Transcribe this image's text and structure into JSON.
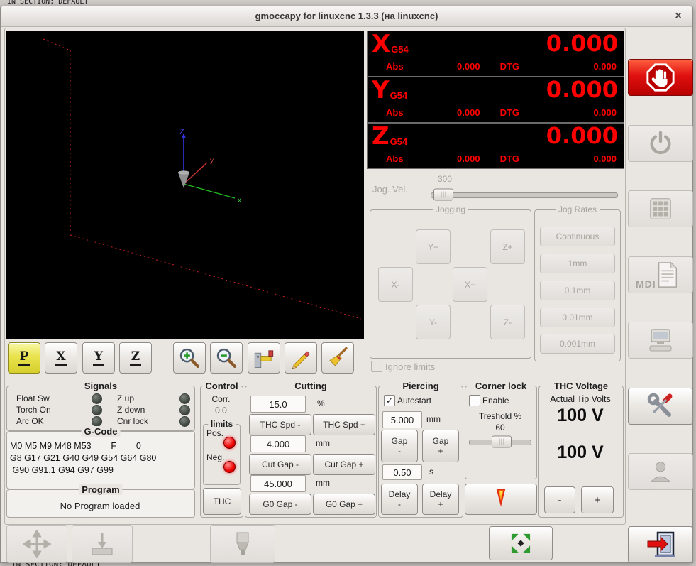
{
  "window": {
    "title": "gmoccapy for linuxcnc   1.3.3 (на linuxcnc)",
    "close_glyph": "×"
  },
  "desktop": {
    "top_fragment": "IN SECTION:  DEFAULT",
    "bottom_fragment": "IN SECTION:  DEFAULT"
  },
  "preview": {
    "axis_labels": {
      "z": "Z",
      "y": "y",
      "x": "x"
    }
  },
  "preview_toolbar": {
    "view_buttons": [
      "P",
      "X",
      "Y",
      "Z"
    ]
  },
  "dro": {
    "axes": [
      {
        "letter": "X",
        "system": "G54",
        "value": "0.000",
        "abs_label": "Abs",
        "abs_value": "0.000",
        "dtg_label": "DTG",
        "dtg_value": "0.000"
      },
      {
        "letter": "Y",
        "system": "G54",
        "value": "0.000",
        "abs_label": "Abs",
        "abs_value": "0.000",
        "dtg_label": "DTG",
        "dtg_value": "0.000"
      },
      {
        "letter": "Z",
        "system": "G54",
        "value": "0.000",
        "abs_label": "Abs",
        "abs_value": "0.000",
        "dtg_label": "DTG",
        "dtg_value": "0.000"
      }
    ]
  },
  "jog": {
    "velocity_label": "Jog. Vel.",
    "velocity_value": "300",
    "jogging_title": "Jogging",
    "axis_buttons": [
      "Y+",
      "Z+",
      "X-",
      "X+",
      "Y-",
      "Z-"
    ],
    "rates_title": "Jog Rates",
    "rate_buttons": [
      "Continuous",
      "1mm",
      "0.1mm",
      "0.01mm",
      "0.001mm"
    ],
    "ignore_limits_label": "Ignore limits"
  },
  "signals": {
    "title": "Signals",
    "left_items": [
      "Float Sw",
      "Torch On",
      "Arc OK"
    ],
    "right_items": [
      "Z up",
      "Z down",
      "Cnr lock"
    ]
  },
  "control": {
    "title": "Control",
    "corr_label": "Corr.",
    "corr_value": "0.0",
    "limits_title": "limits",
    "pos_label": "Pos.",
    "neg_label": "Neg.",
    "thc_button": "THC"
  },
  "gcode": {
    "title": "G-Code",
    "lines": [
      "M0 M5 M9 M48 M53        F        0",
      "G8 G17 G21 G40 G49 G54 G64 G80",
      " G90 G91.1 G94 G97 G99"
    ]
  },
  "program": {
    "title": "Program",
    "status": "No Program loaded"
  },
  "cutting": {
    "title": "Cutting",
    "feed_value": "15.0",
    "feed_unit": "%",
    "thc_spd_minus": "THC Spd -",
    "thc_spd_plus": "THC Spd +",
    "cut_gap_value": "4.000",
    "cut_gap_unit": "mm",
    "cut_gap_minus": "Cut Gap -",
    "cut_gap_plus": "Cut Gap +",
    "g0_gap_value": "45.000",
    "g0_gap_unit": "mm",
    "g0_gap_minus": "G0 Gap -",
    "g0_gap_plus": "G0 Gap +"
  },
  "piercing": {
    "title": "Piercing",
    "autostart_label": "Autostart",
    "autostart_check": "✓",
    "gap_value": "5.000",
    "gap_unit": "mm",
    "gap_minus": "Gap\n-",
    "gap_plus": "Gap\n+",
    "delay_value": "0.50",
    "delay_unit": "s",
    "delay_minus": "Delay\n-",
    "delay_plus": "Delay\n+"
  },
  "corner_lock": {
    "title": "Corner lock",
    "enable_label": "Enable",
    "threshold_label": "Treshold %",
    "threshold_value": "60"
  },
  "thc_voltage": {
    "title": "THC Voltage",
    "subtitle": "Actual Tip Volts",
    "actual_value": "100 V",
    "target_value": "100 V",
    "minus_label": "-",
    "plus_label": "+"
  },
  "sidebar": {
    "mdi_label": "MDI"
  },
  "colors": {
    "dro_red": "#ff0000",
    "estop_red": "#cc1010",
    "led_on_red": "#ee0000",
    "led_off_gray": "#3c423c",
    "selected_view_yellow": "#e9e34e",
    "expand_green": "#2f9a2f"
  }
}
